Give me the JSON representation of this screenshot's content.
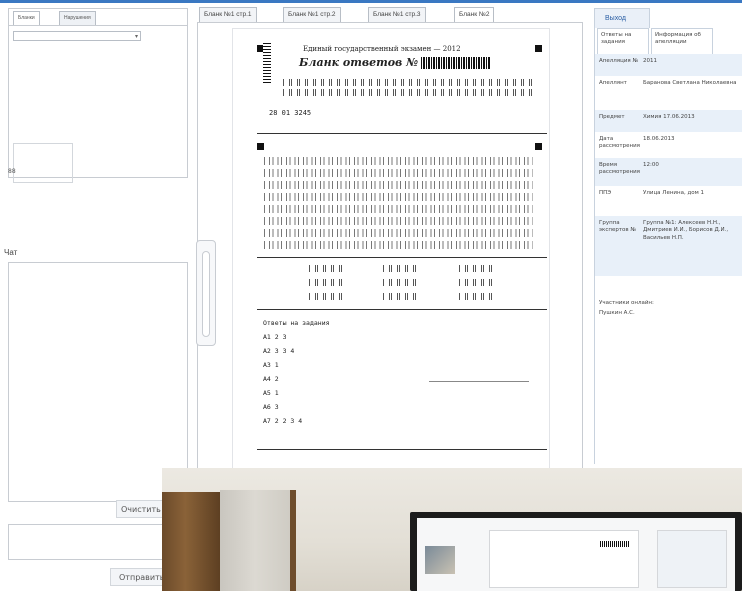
{
  "left_panel": {
    "tabs": [
      "Бланки",
      "Нарушения"
    ],
    "select_value": "",
    "small_label": "88",
    "chat_label": "Чат",
    "clear_button": "Очистить",
    "send_button": "Отправить"
  },
  "form_tabs": [
    "Бланк №1 стр.1",
    "Бланк №1 стр.2",
    "Бланк №1 стр.3",
    "Бланк №2"
  ],
  "sheet": {
    "header": "Единый государственный экзамен — 2012",
    "title": "Бланк ответов № 1",
    "region_code": "28 01 3245",
    "answer_lines": [
      "Ответы на задания",
      "А1 2 3",
      "А2 3 3 4",
      "А3 1",
      "А4 2",
      "А5 1",
      "А6 3",
      "А7 2 2 3 4"
    ]
  },
  "right_panel": {
    "exit_tab": "Выход",
    "sub_tabs": [
      "Ответы на задания",
      "Информация об апелляции"
    ],
    "rows": [
      {
        "k": "Апелляция №",
        "v": "2011"
      },
      {
        "k": "Апеллянт",
        "v": "Баранова Светлана Николаевна"
      },
      {
        "k": "Предмет",
        "v": "Химия 17.06.2013"
      },
      {
        "k": "Дата рассмотрения",
        "v": "18.06.2013"
      },
      {
        "k": "Время рассмотрения",
        "v": "12:00"
      },
      {
        "k": "ППЭ",
        "v": "Улица Ленина, дом 1"
      },
      {
        "k": "Группа экспертов №",
        "v": "Группа №1: Алексеев Н.Н., Дмитриев И.И., Борисов Д.И., Васильев Н.П."
      }
    ],
    "online_label": "Участники онлайн:",
    "online_user": "Пушкин А.С."
  },
  "colors": {
    "accent": "#3a78c2",
    "row_alt": "#e8f0f9"
  }
}
